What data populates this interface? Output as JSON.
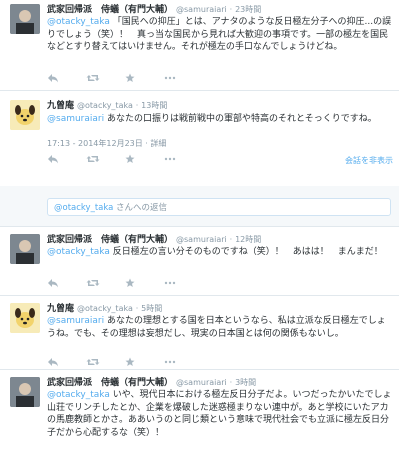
{
  "tweets": [
    {
      "name": "武家回帰派　侍蟻（有門大輔）",
      "handle": "@samuraiari",
      "time": "23時間",
      "mention": "@otacky_taka",
      "text": "「国民への抑圧」とは、アナタのような反日極左分子への抑圧...の誤りでしょう（笑）！　真っ当な国民から見れば大歓迎の事項です。一部の極左を国民などとすり替えてはいけません。それが極左の手口なんでしょうけどね。"
    },
    {
      "name": "九曾庵",
      "handle": "@otacky_taka",
      "time": "13時間",
      "mention": "@samuraiari",
      "text": "あなたの口振りは戦前戦中の軍部や特高のそれとそっくりですね。",
      "meta": "17:13 - 2014年12月23日 · 詳細",
      "hide": "会話を非表示"
    },
    {
      "name": "武家回帰派　侍蟻（有門大輔）",
      "handle": "@samuraiari",
      "time": "12時間",
      "mention": "@otacky_taka",
      "text": "反日極左の言い分そのものですね（笑）！　あはは！　まんまだ！"
    },
    {
      "name": "九曾庵",
      "handle": "@otacky_taka",
      "time": "5時間",
      "mention": "@samuraiari",
      "text": "あなたの理想とする国を日本というなら、私は立派な反日極左でしょうね。でも、その理想は妄想だし、現実の日本国とは何の関係もないし。"
    },
    {
      "name": "武家回帰派　侍蟻（有門大輔）",
      "handle": "@samuraiari",
      "time": "3時間",
      "mention": "@otacky_taka",
      "text": "いや、現代日本における極左反日分子だよ。いつだったかいたでしょ山荘でリンチしたとか、企業を爆破した迷惑極まりない連中が。あと学校にいたアカの馬鹿教師とかさ。ああいうのと同じ類という意味で現代社会でも立派に極左反日分子だから心配するな（笑）！"
    }
  ],
  "reply": {
    "mention": "@otacky_taka",
    "suffix": "さんへの返信"
  },
  "sep": "·",
  "colors": {
    "link": "#55acee",
    "meta": "#8899a6",
    "text": "#292f33"
  },
  "icons": [
    "reply-icon",
    "retweet-icon",
    "favorite-icon",
    "more-icon"
  ]
}
